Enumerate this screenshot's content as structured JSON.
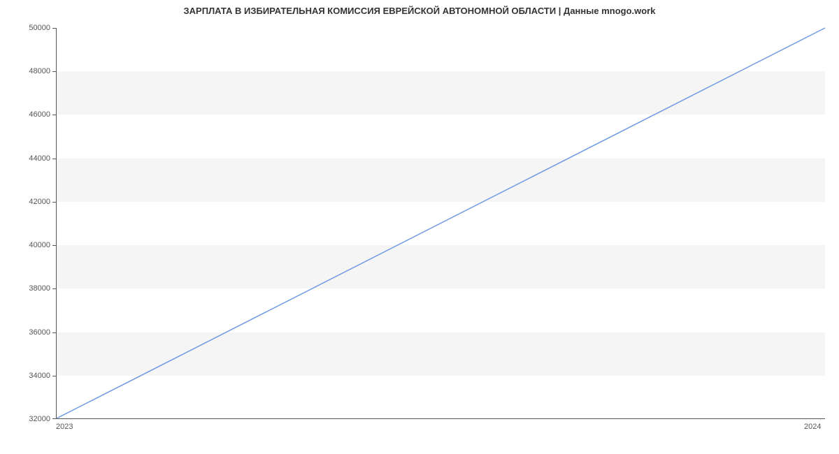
{
  "chart_data": {
    "type": "line",
    "title": "ЗАРПЛАТА В ИЗБИРАТЕЛЬНАЯ КОМИССИЯ ЕВРЕЙСКОЙ АВТОНОМНОЙ ОБЛАСТИ | Данные mnogo.work",
    "x": [
      "2023",
      "2024"
    ],
    "values": [
      32000,
      50000
    ],
    "xlabel": "",
    "ylabel": "",
    "ylim": [
      32000,
      50000
    ],
    "y_ticks": [
      32000,
      34000,
      36000,
      38000,
      40000,
      42000,
      44000,
      46000,
      48000,
      50000
    ],
    "line_color": "#6f9ae3"
  }
}
